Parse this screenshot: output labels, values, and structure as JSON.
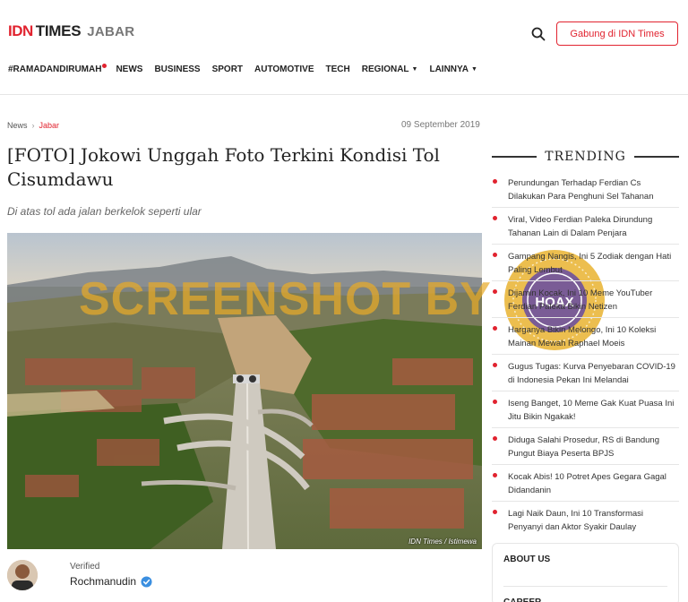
{
  "header": {
    "logo_idn": "IDN",
    "logo_times": "TIMES",
    "logo_region": "JABAR",
    "join_label": "Gabung di IDN Times"
  },
  "nav": {
    "items": [
      "#RAMADANDIRUMAH",
      "NEWS",
      "BUSINESS",
      "SPORT",
      "AUTOMOTIVE",
      "TECH",
      "REGIONAL",
      "LAINNYA"
    ]
  },
  "breadcrumb": {
    "home": "News",
    "separator": "›",
    "current": "Jabar"
  },
  "article": {
    "date": "09 September 2019",
    "title": "[FOTO] Jokowi Unggah Foto Terkini Kondisi Tol Cisumdawu",
    "subtitle": "Di atas tol ada jalan berkelok seperti ular",
    "image_credit": "IDN Times / Istimewa",
    "author_status": "Verified",
    "author_name": "Rochmanudin"
  },
  "overlay": {
    "watermark": "SCREENSHOT BY",
    "stamp_text": "HOAX"
  },
  "trending": {
    "title": "TRENDING",
    "items": [
      "Perundungan Terhadap Ferdian Cs Dilakukan Para Penghuni Sel Tahanan",
      "Viral, Video Ferdian Paleka Dirundung Tahanan Lain di Dalam Penjara",
      "Gampang Nangis, Ini 5 Zodiak dengan Hati Paling Lembut",
      "Dijamin Kocak, Ini 10 Meme YouTuber Ferdian Paleka Bikin Netizen",
      "Harganya Bikin Melongo, Ini 10 Koleksi Mainan Mewah Raphael Moeis",
      "Gugus Tugas: Kurva Penyebaran COVID-19 di Indonesia Pekan Ini Melandai",
      "Iseng Banget, 10 Meme Gak Kuat Puasa Ini Jitu Bikin Ngakak!",
      "Diduga Salahi Prosedur, RS di Bandung Pungut Biaya Peserta BPJS",
      "Kocak Abis! 10 Potret Apes Gegara Gagal Didandanin",
      "Lagi Naik Daun, Ini 10 Transformasi Penyanyi dan Aktor Syakir Daulay"
    ]
  },
  "footer_links": {
    "about": "ABOUT US",
    "career": "CAREER"
  },
  "colors": {
    "brand_red": "#e1232f",
    "watermark_gold": "#e8aa28",
    "stamp_purple": "#6a4fa0"
  }
}
